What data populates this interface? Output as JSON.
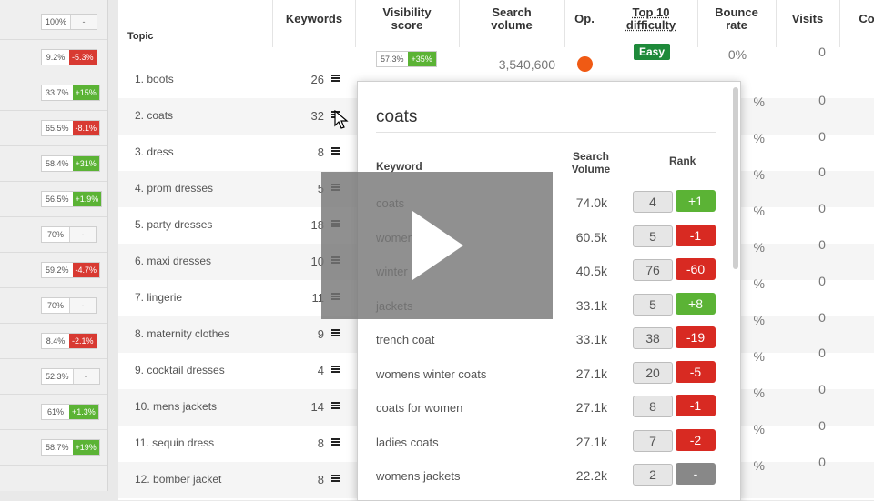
{
  "left_strip": [
    {
      "pct": "100%",
      "chg": "-",
      "dir": "none"
    },
    {
      "pct": "9.2%",
      "chg": "-5.3%",
      "dir": "down"
    },
    {
      "pct": "33.7%",
      "chg": "+15%",
      "dir": "up"
    },
    {
      "pct": "65.5%",
      "chg": "-8.1%",
      "dir": "down"
    },
    {
      "pct": "58.4%",
      "chg": "+31%",
      "dir": "up"
    },
    {
      "pct": "56.5%",
      "chg": "+1.9%",
      "dir": "up"
    },
    {
      "pct": "70%",
      "chg": "-",
      "dir": "none"
    },
    {
      "pct": "59.2%",
      "chg": "-4.7%",
      "dir": "down"
    },
    {
      "pct": "70%",
      "chg": "-",
      "dir": "none"
    },
    {
      "pct": "8.4%",
      "chg": "-2.1%",
      "dir": "down"
    },
    {
      "pct": "52.3%",
      "chg": "-",
      "dir": "none"
    },
    {
      "pct": "61%",
      "chg": "+1.3%",
      "dir": "up"
    },
    {
      "pct": "58.7%",
      "chg": "+19%",
      "dir": "up"
    }
  ],
  "headers": {
    "topic": "Topic",
    "keywords": "Keywords",
    "visibility": "Visibility score",
    "search_volume": "Search volume",
    "op": "Op.",
    "top10": "Top 10 difficulty",
    "bounce": "Bounce rate",
    "visits": "Visits",
    "co": "Co"
  },
  "topics": [
    {
      "name": "1. boots",
      "keywords": "26",
      "bounce": "0%",
      "visits": "0"
    },
    {
      "name": "2. coats",
      "keywords": "32",
      "bounce": "%",
      "visits": "0"
    },
    {
      "name": "3. dress",
      "keywords": "8",
      "bounce": "%",
      "visits": "0"
    },
    {
      "name": "4. prom dresses",
      "keywords": "5",
      "bounce": "%",
      "visits": "0"
    },
    {
      "name": "5. party dresses",
      "keywords": "18",
      "bounce": "%",
      "visits": "0"
    },
    {
      "name": "6. maxi dresses",
      "keywords": "10",
      "bounce": "%",
      "visits": "0"
    },
    {
      "name": "7. lingerie",
      "keywords": "11",
      "bounce": "%",
      "visits": "0"
    },
    {
      "name": "8. maternity clothes",
      "keywords": "9",
      "bounce": "%",
      "visits": "0"
    },
    {
      "name": "9. cocktail dresses",
      "keywords": "4",
      "bounce": "%",
      "visits": "0"
    },
    {
      "name": "10. mens jackets",
      "keywords": "14",
      "bounce": "%",
      "visits": "0"
    },
    {
      "name": "11. sequin dress",
      "keywords": "8",
      "bounce": "%",
      "visits": "0"
    },
    {
      "name": "12. bomber jacket",
      "keywords": "8",
      "bounce": "%",
      "visits": "0"
    }
  ],
  "first_row": {
    "vis_pct": "57.3%",
    "vis_chg": "+35%",
    "search_volume": "3,540,600",
    "difficulty": "Easy",
    "op_color": "#f05a14"
  },
  "popup": {
    "title": "coats",
    "col_keyword": "Keyword",
    "col_volume": "Search Volume",
    "col_rank": "Rank",
    "rows": [
      {
        "keyword": "coats",
        "volume": "74.0k",
        "rank": "4",
        "chg": "+1",
        "dir": "up"
      },
      {
        "keyword": "women",
        "volume": "60.5k",
        "rank": "5",
        "chg": "-1",
        "dir": "down"
      },
      {
        "keyword": "winter",
        "volume": "40.5k",
        "rank": "76",
        "chg": "-60",
        "dir": "down"
      },
      {
        "keyword": "jackets",
        "volume": "33.1k",
        "rank": "5",
        "chg": "+8",
        "dir": "up"
      },
      {
        "keyword": "trench coat",
        "volume": "33.1k",
        "rank": "38",
        "chg": "-19",
        "dir": "down"
      },
      {
        "keyword": "womens winter coats",
        "volume": "27.1k",
        "rank": "20",
        "chg": "-5",
        "dir": "down"
      },
      {
        "keyword": "coats for women",
        "volume": "27.1k",
        "rank": "8",
        "chg": "-1",
        "dir": "down"
      },
      {
        "keyword": "ladies coats",
        "volume": "27.1k",
        "rank": "7",
        "chg": "-2",
        "dir": "down"
      },
      {
        "keyword": "womens jackets",
        "volume": "22.2k",
        "rank": "2",
        "chg": "-",
        "dir": "none"
      }
    ]
  },
  "icons": {
    "menu": "hamburger-menu-icon",
    "play": "play-icon",
    "cursor": "mouse-cursor-icon",
    "op": "status-dot-icon"
  },
  "colors": {
    "up": "#5bb335",
    "down": "#d83a32",
    "easy": "#1e8a3a",
    "op_dot": "#f05a14"
  }
}
